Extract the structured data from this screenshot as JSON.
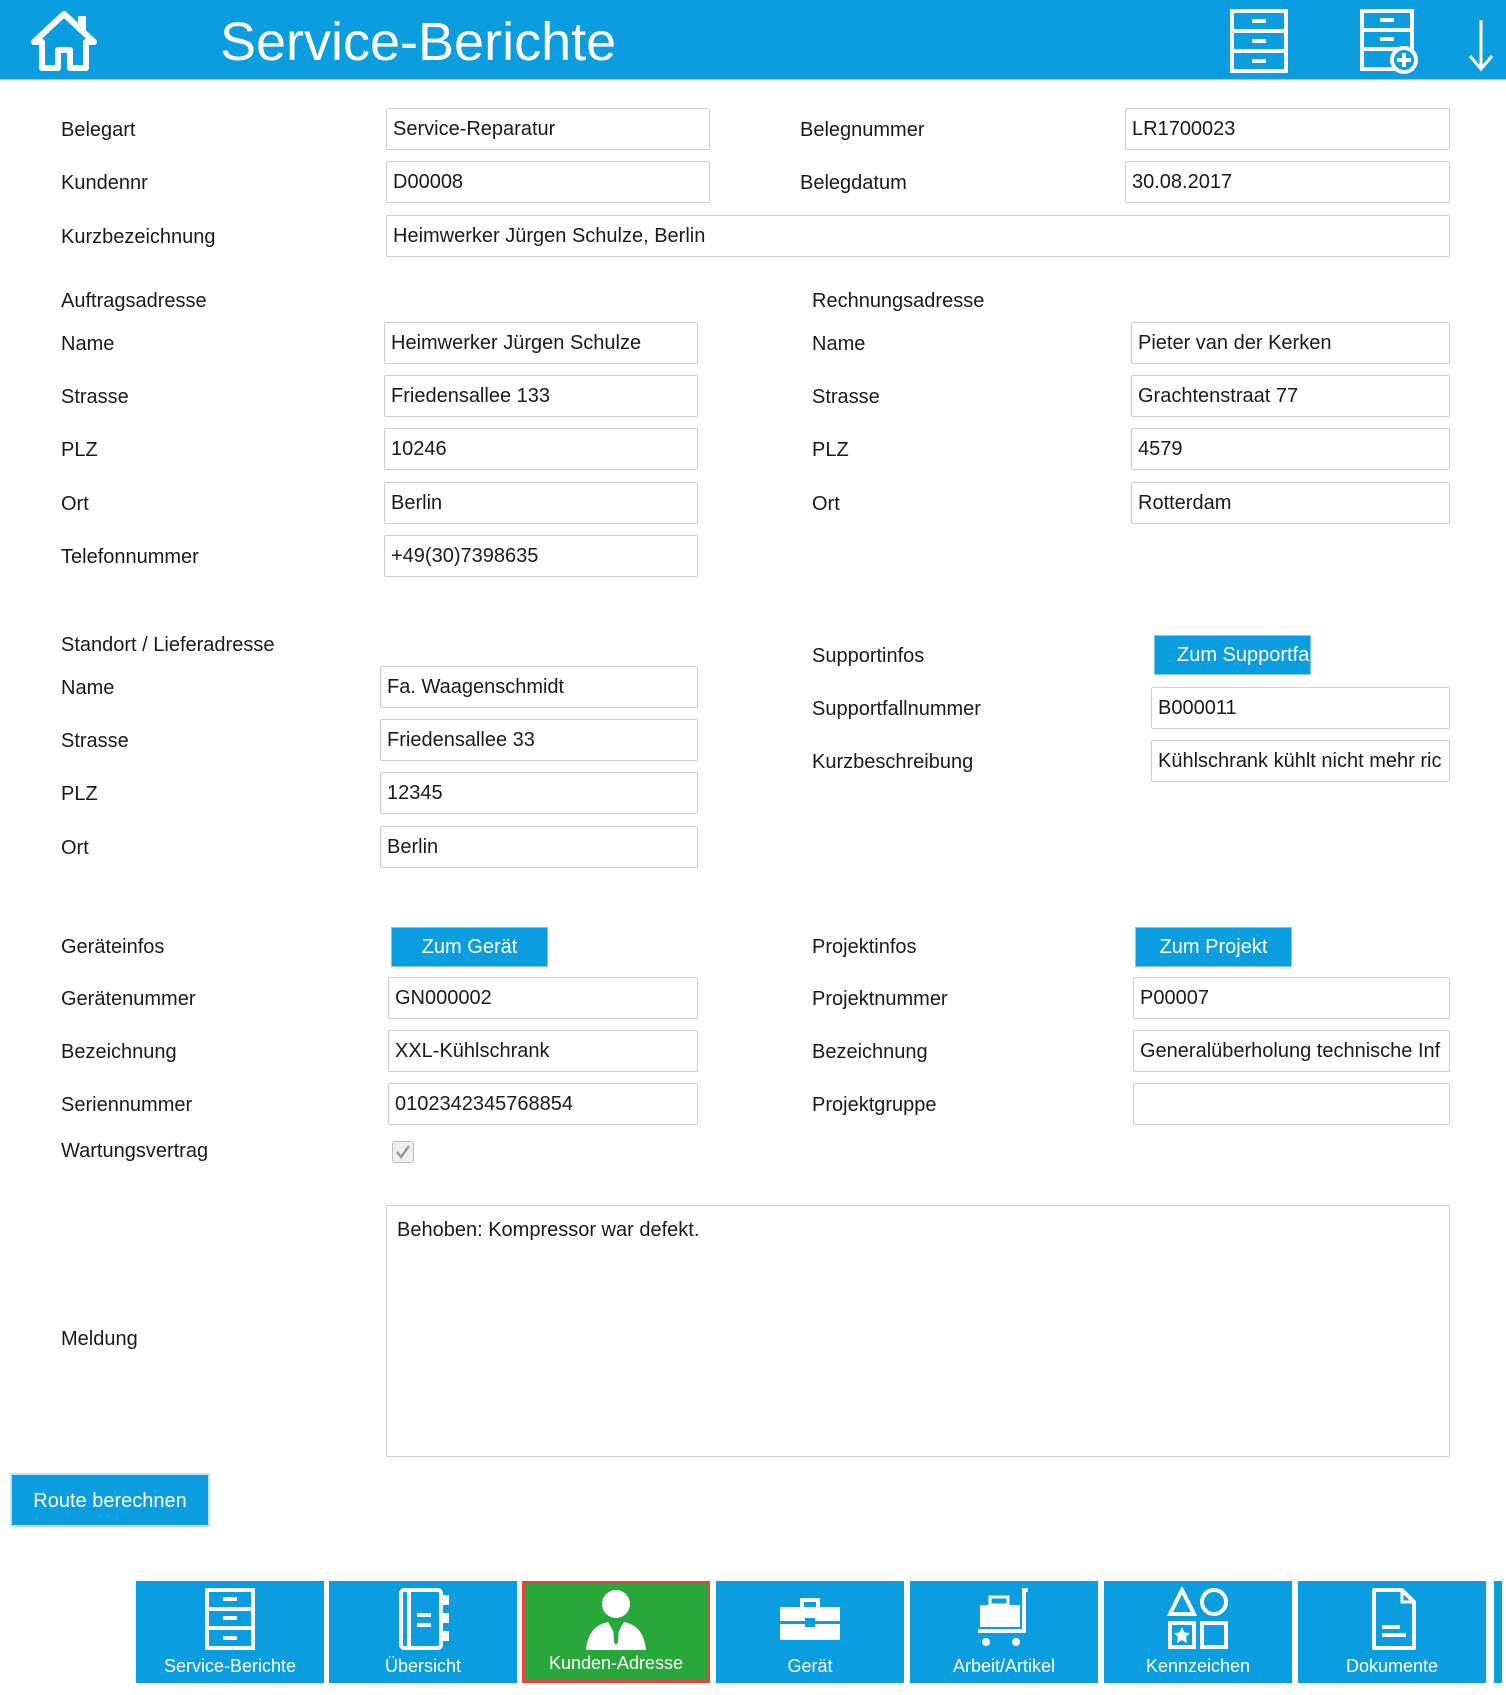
{
  "header": {
    "title": "Service-Berichte"
  },
  "colors": {
    "accent": "#0a9de0",
    "active_tab": "#28a83a",
    "active_border": "#e2463f"
  },
  "beleg": {
    "belegart_label": "Belegart",
    "belegart_value": "Service-Reparatur",
    "belegnummer_label": "Belegnummer",
    "belegnummer_value": "LR1700023",
    "kundennr_label": "Kundennr",
    "kundennr_value": "D00008",
    "belegdatum_label": "Belegdatum",
    "belegdatum_value": "30.08.2017",
    "kurzbezeichnung_label": "Kurzbezeichnung",
    "kurzbezeichnung_value": "Heimwerker Jürgen Schulze, Berlin"
  },
  "auftragsadresse": {
    "heading": "Auftragsadresse",
    "name_label": "Name",
    "name_value": "Heimwerker Jürgen Schulze",
    "strasse_label": "Strasse",
    "strasse_value": "Friedensallee 133",
    "plz_label": "PLZ",
    "plz_value": "10246",
    "ort_label": "Ort",
    "ort_value": "Berlin",
    "telefon_label": "Telefonnummer",
    "telefon_value": "+49(30)7398635"
  },
  "rechnungsadresse": {
    "heading": "Rechnungsadresse",
    "name_label": "Name",
    "name_value": "Pieter van der Kerken",
    "strasse_label": "Strasse",
    "strasse_value": "Grachtenstraat 77",
    "plz_label": "PLZ",
    "plz_value": "4579",
    "ort_label": "Ort",
    "ort_value": "Rotterdam"
  },
  "lieferadresse": {
    "heading": "Standort / Lieferadresse",
    "name_label": "Name",
    "name_value": "Fa. Waagenschmidt",
    "strasse_label": "Strasse",
    "strasse_value": "Friedensallee 33",
    "plz_label": "PLZ",
    "plz_value": "12345",
    "ort_label": "Ort",
    "ort_value": "Berlin"
  },
  "support": {
    "heading": "Supportinfos",
    "button_label": "Zum Supportfa",
    "nummer_label": "Supportfallnummer",
    "nummer_value": "B000011",
    "beschreibung_label": "Kurzbeschreibung",
    "beschreibung_value": "Kühlschrank kühlt nicht mehr ric"
  },
  "geraet": {
    "heading": "Geräteinfos",
    "button_label": "Zum Gerät",
    "nummer_label": "Gerätenummer",
    "nummer_value": "GN000002",
    "bezeichnung_label": "Bezeichnung",
    "bezeichnung_value": "XXL-Kühlschrank",
    "serie_label": "Seriennummer",
    "serie_value": "0102342345768854",
    "wartung_label": "Wartungsvertrag"
  },
  "projekt": {
    "heading": "Projektinfos",
    "button_label": "Zum Projekt",
    "nummer_label": "Projektnummer",
    "nummer_value": "P00007",
    "bezeichnung_label": "Bezeichnung",
    "bezeichnung_value": "Generalüberholung technische Inf",
    "gruppe_label": "Projektgruppe",
    "gruppe_value": ""
  },
  "meldung": {
    "label": "Meldung",
    "text": "Behoben: Kompressor war defekt."
  },
  "route_button": "Route berechnen",
  "nav": [
    {
      "label": "Service-Berichte",
      "icon": "cabinet-icon"
    },
    {
      "label": "Übersicht",
      "icon": "notebook-icon"
    },
    {
      "label": "Kunden-Adresse",
      "icon": "person-icon",
      "active": true
    },
    {
      "label": "Gerät",
      "icon": "toolbox-icon"
    },
    {
      "label": "Arbeit/Artikel",
      "icon": "cart-icon"
    },
    {
      "label": "Kennzeichen",
      "icon": "shapes-icon"
    },
    {
      "label": "Dokumente",
      "icon": "document-icon"
    }
  ]
}
